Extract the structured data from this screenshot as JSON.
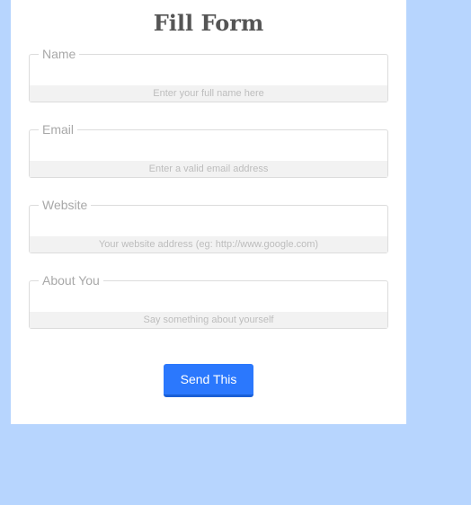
{
  "form": {
    "title": "Fill Form",
    "fields": [
      {
        "label": "Name",
        "hint": "Enter your full name here",
        "value": ""
      },
      {
        "label": "Email",
        "hint": "Enter a valid email address",
        "value": ""
      },
      {
        "label": "Website",
        "hint": "Your website address (eg: http://www.google.com)",
        "value": ""
      },
      {
        "label": "About You",
        "hint": "Say something about yourself",
        "value": ""
      }
    ],
    "submit_label": "Send This"
  },
  "colors": {
    "background": "#b7d5fe",
    "card": "#ffffff",
    "button": "#2b78fd",
    "title_text": "#555555",
    "label_text": "#a8a8a8",
    "hint_background": "#f2f2f2"
  }
}
